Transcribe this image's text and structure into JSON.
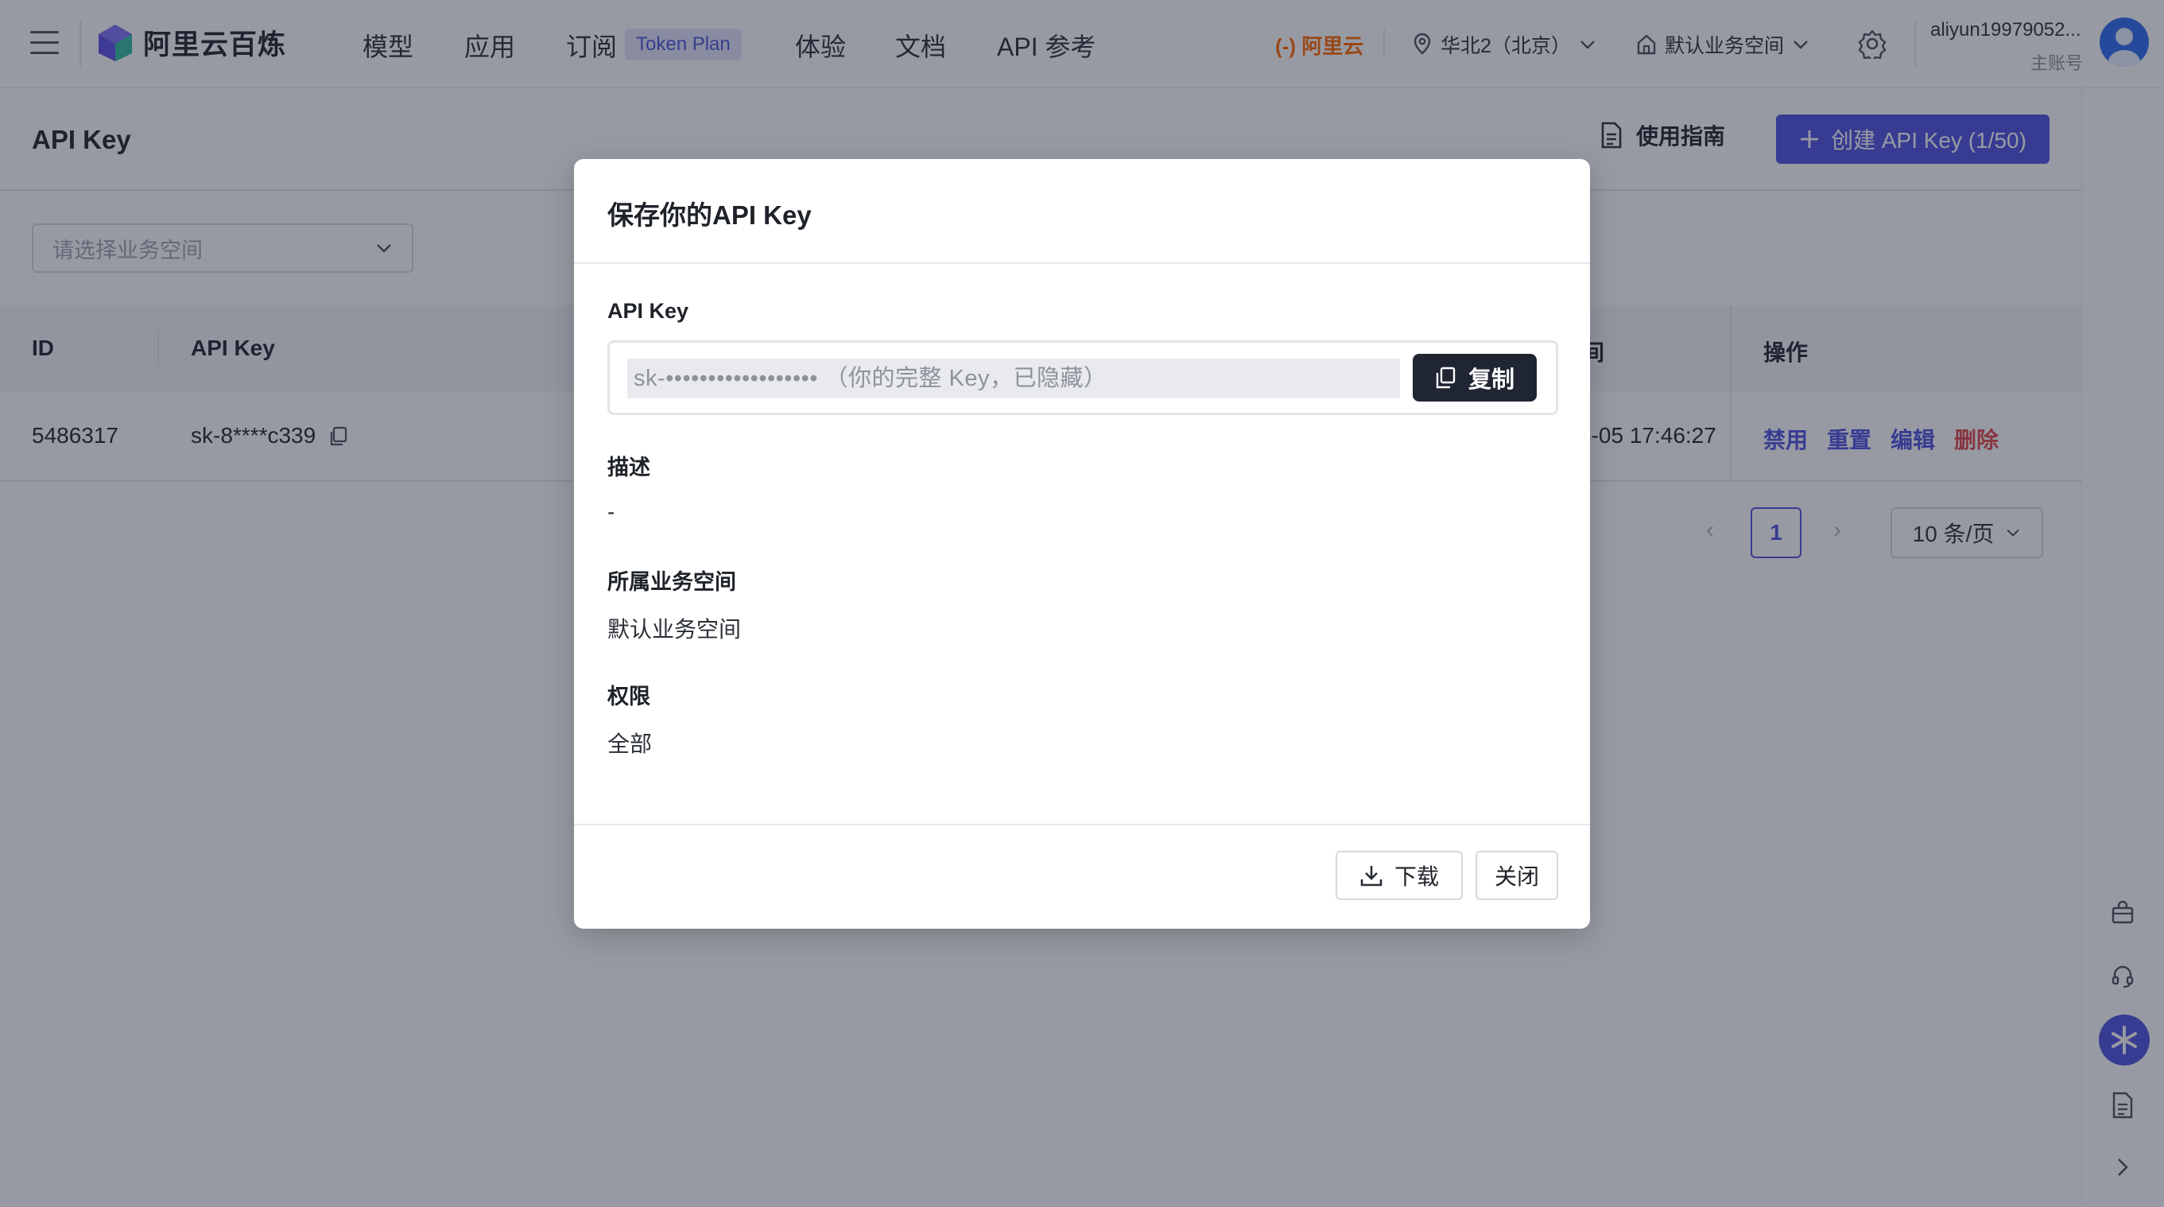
{
  "brand": {
    "name": "阿里云百炼"
  },
  "nav": {
    "items": [
      "模型",
      "应用",
      "订阅",
      "体验",
      "文档",
      "API 参考"
    ],
    "token_badge": "Token Plan",
    "aliyun_logo": "(-) 阿里云",
    "region": "华北2（北京）",
    "workspace": "默认业务空间",
    "user_name": "aliyun19979052...",
    "user_role": "主账号"
  },
  "page": {
    "title": "API Key",
    "guide_label": "使用指南",
    "create_label": "创建 API Key (1/50)",
    "filter_placeholder": "请选择业务空间"
  },
  "table": {
    "columns": {
      "id": "ID",
      "api_key": "API Key",
      "time_partial": "间",
      "ops": "操作"
    },
    "rows": [
      {
        "id": "5486317",
        "api_key": "sk-8****c339",
        "time_partial": "6-05 17:46:27",
        "ops": {
          "disable": "禁用",
          "reset": "重置",
          "edit": "编辑",
          "delete": "删除"
        }
      }
    ]
  },
  "pagination": {
    "prev": "‹",
    "current": "1",
    "next": "›",
    "page_size": "10 条/页"
  },
  "modal": {
    "title": "保存你的API Key",
    "key_label": "API Key",
    "key_value": "sk-••••••••••••••••••  （你的完整 Key，已隐藏）",
    "copy_label": "复制",
    "desc_label": "描述",
    "desc_value": "-",
    "workspace_label": "所属业务空间",
    "workspace_value": "默认业务空间",
    "perm_label": "权限",
    "perm_value": "全部",
    "download_label": "下载",
    "close_label": "关闭"
  },
  "colors": {
    "accent": "#4d52e0",
    "danger": "#e0464a",
    "dark_button": "#1f2533",
    "aliyun_orange": "#ff6a00"
  }
}
